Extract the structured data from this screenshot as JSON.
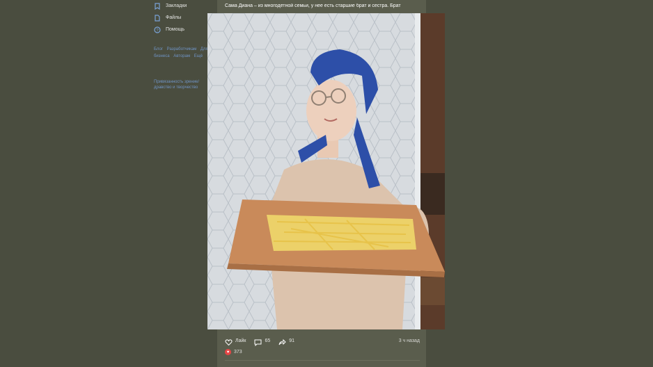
{
  "sidebar": {
    "items": [
      {
        "label": "Закладки",
        "icon": "bookmark-icon"
      },
      {
        "label": "Файлы",
        "icon": "file-icon"
      },
      {
        "label": "Помощь",
        "icon": "help-icon"
      }
    ],
    "footer_links": [
      "Блог",
      "Разработчикам",
      "Для бизнеса",
      "Авторам",
      "Ещё"
    ],
    "promo": "Привязанность зрение/дравство и творчество"
  },
  "post": {
    "text": "Сама Диана – из многодетной семьи, у нее есть старшие брат и сестра. Брат",
    "actions": {
      "like": {
        "label": "Лайк",
        "icon": "heart-icon"
      },
      "comment": {
        "label": "65",
        "icon": "comment-icon"
      },
      "share": {
        "label": "91",
        "icon": "share-icon"
      }
    },
    "time": "3 ч назад",
    "reactions_count": "373"
  },
  "colors": {
    "background": "#4a4d3f",
    "panel": "#5a5d4d",
    "link": "#6f93c4",
    "reaction": "#e64646",
    "scarf": "#2d4fa8",
    "board": "#c98a5a",
    "cheese": "#f0d86a"
  }
}
